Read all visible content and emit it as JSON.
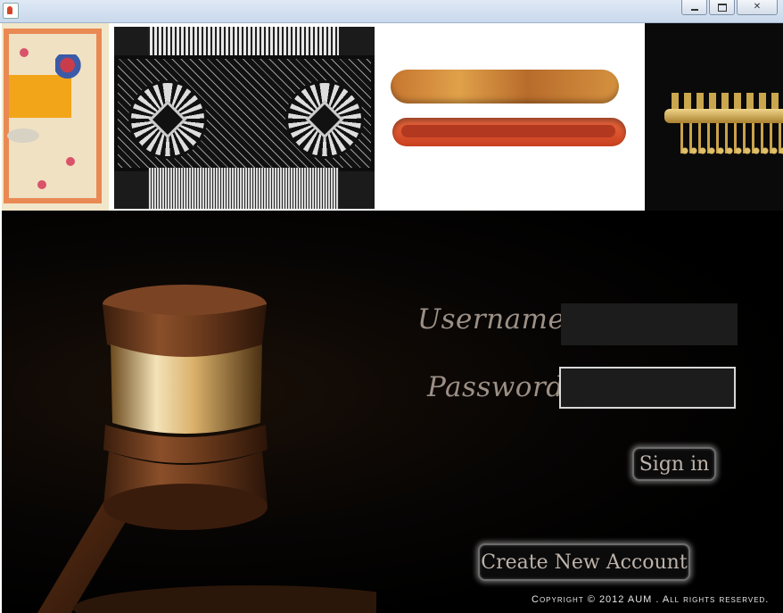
{
  "window": {
    "close_glyph": "✕"
  },
  "banner": {
    "items": [
      "miniature-painting",
      "inlaid-comb",
      "lacquer-pen-case",
      "gold-ornament"
    ]
  },
  "login": {
    "username_label": "Username",
    "password_label": "Password",
    "username_value": "",
    "password_value": "",
    "signin_label": "Sign in",
    "create_account_label": "Create New Account"
  },
  "footer": {
    "copyright": "Copyright © 2012 AUM . All rights reserved."
  },
  "icons": [
    "java-app-icon",
    "minimize-icon",
    "maximize-icon",
    "close-icon",
    "gavel-image"
  ],
  "colors": {
    "label_text": "#9c9086",
    "field_bg": "#1c1c1c",
    "button_glow": "#bebebe",
    "background": "#000000"
  }
}
